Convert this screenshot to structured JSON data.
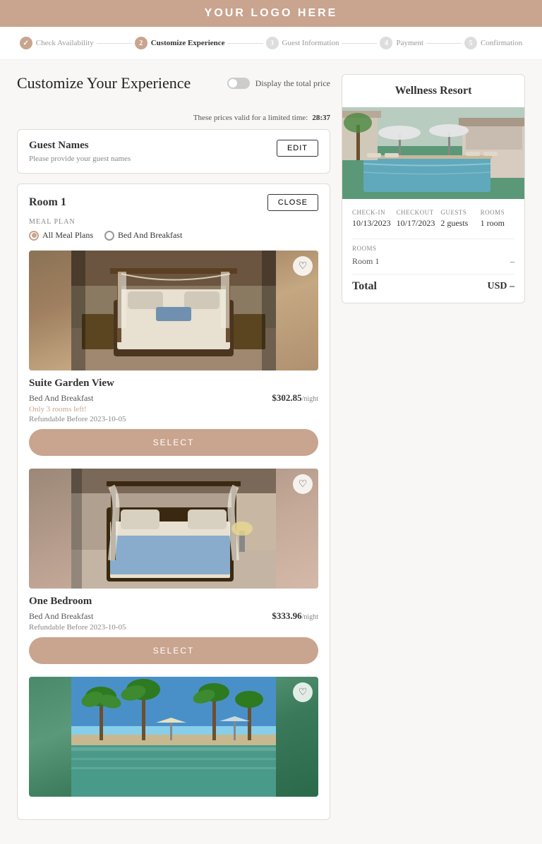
{
  "header": {
    "logo": "YOUR LOGO HERE"
  },
  "progress": {
    "steps": [
      {
        "id": 1,
        "label": "Check Availability",
        "state": "done"
      },
      {
        "id": 2,
        "label": "Customize Experience",
        "state": "active"
      },
      {
        "id": 3,
        "label": "Guest Information",
        "state": "inactive"
      },
      {
        "id": 4,
        "label": "Payment",
        "state": "inactive"
      },
      {
        "id": 5,
        "label": "Confirmation",
        "state": "inactive"
      }
    ]
  },
  "page": {
    "title": "Customize Your Experience",
    "toggle_label": "Display the total price",
    "timer_label": "These prices valid for a limited time:",
    "timer_value": "28:37"
  },
  "guest_names": {
    "title": "Guest Names",
    "subtitle": "Please provide your guest names",
    "edit_label": "EDIT"
  },
  "room1": {
    "title": "Room 1",
    "close_label": "CLOSE",
    "meal_plan_label": "MEAL PLAN",
    "meal_options": [
      {
        "id": "all",
        "label": "All Meal Plans",
        "selected": true
      },
      {
        "id": "bb",
        "label": "Bed And Breakfast",
        "selected": false
      }
    ],
    "options": [
      {
        "name": "Suite Garden View",
        "meal": "Bed And Breakfast",
        "price": "$302.85",
        "per_night": "/night",
        "rooms_left": "Only 3 rooms left!",
        "refundable": "Refundable Before 2023-10-05",
        "select_label": "SELECT",
        "img_type": "bedroom1"
      },
      {
        "name": "One Bedroom",
        "meal": "Bed And Breakfast",
        "price": "$333.96",
        "per_night": "/night",
        "rooms_left": "",
        "refundable": "Refundable Before 2023-10-05",
        "select_label": "SELECT",
        "img_type": "bedroom2"
      },
      {
        "name": "",
        "meal": "",
        "price": "",
        "per_night": "",
        "rooms_left": "",
        "refundable": "",
        "select_label": "",
        "img_type": "pool2"
      }
    ]
  },
  "summary": {
    "hotel_name": "Wellness Resort",
    "checkin_label": "CHECK-IN",
    "checkin_value": "10/13/2023",
    "checkout_label": "CHECKOUT",
    "checkout_value": "10/17/2023",
    "guests_label": "GUESTS",
    "guests_value": "2 guests",
    "rooms_label": "ROOMS",
    "rooms_value": "1 room",
    "rooms_section_label": "ROOMS",
    "room1_label": "Room 1",
    "room1_value": "–",
    "total_label": "Total",
    "total_value": "USD –"
  }
}
